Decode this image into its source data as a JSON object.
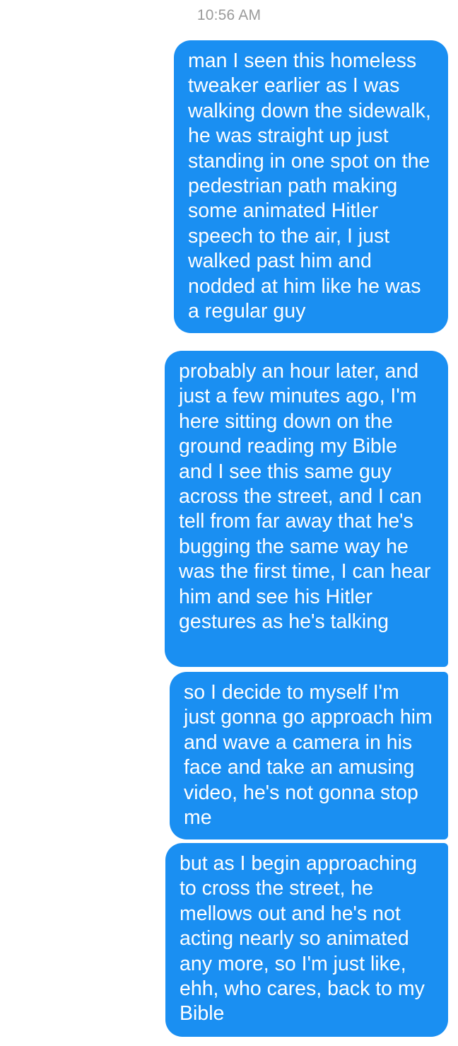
{
  "thread": {
    "timestamp": "10:56 AM",
    "messages": [
      {
        "text": "man I seen this homeless tweaker earlier as I was walking down the sidewalk, he was straight up just standing in one spot on the pedestrian path making some animated Hitler speech to the air, I just walked past him and nodded at him like he was a regular guy"
      },
      {
        "text": "probably an hour later, and just a few minutes ago, I'm here sitting down on the ground reading my Bible and I see this same guy across the street, and I can tell from far away that he's bugging the same way he was the first time, I can hear him and see his Hitler gestures as he's talking"
      },
      {
        "text": "so I decide to myself I'm just gonna go approach him and wave a camera in his face and take an amusing video, he's not gonna stop me"
      },
      {
        "text": "but as I begin approaching to cross the street, he mellows out and he's not acting nearly so animated any more, so I'm just like, ehh, who cares, back to my Bible"
      }
    ]
  },
  "colors": {
    "bubble": "#1a8ff2",
    "bubble_text": "#ffffff",
    "timestamp": "#9a9a9a",
    "background": "#ffffff"
  }
}
